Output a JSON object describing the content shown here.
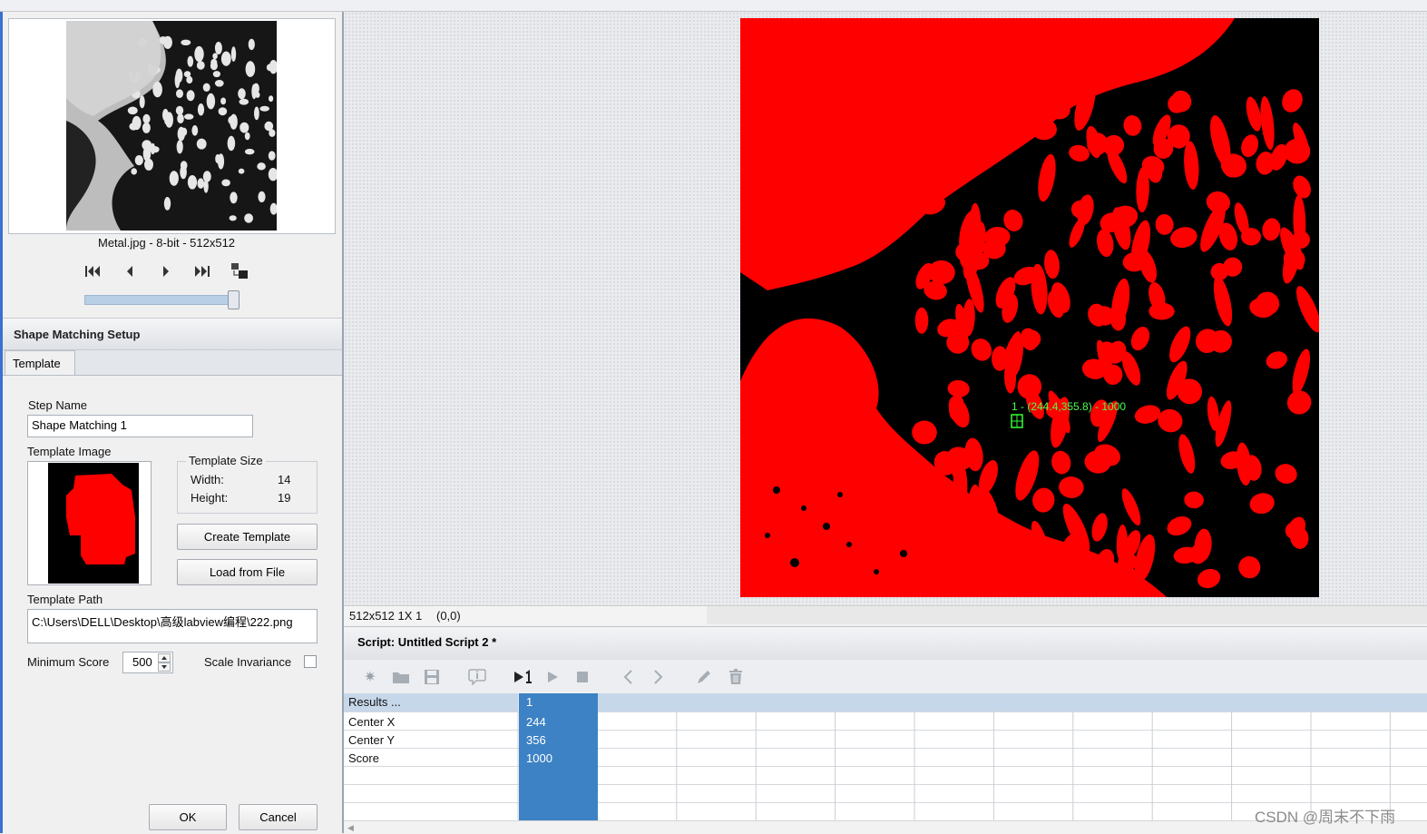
{
  "thumbnail": {
    "caption": "Metal.jpg - 8-bit - 512x512"
  },
  "setup": {
    "title": "Shape Matching Setup",
    "tab": "Template",
    "step_name_label": "Step Name",
    "step_name_value": "Shape Matching 1",
    "template_image_label": "Template Image",
    "template_size_label": "Template Size",
    "width_label": "Width:",
    "width_value": "14",
    "height_label": "Height:",
    "height_value": "19",
    "create_template": "Create Template",
    "load_from_file": "Load from File",
    "template_path_label": "Template Path",
    "template_path_value": "C:\\Users\\DELL\\Desktop\\高级labview编程\\222.png",
    "min_score_label": "Minimum Score",
    "min_score_value": "500",
    "scale_invariance_label": "Scale Invariance",
    "scale_invariance_checked": false,
    "ok": "OK",
    "cancel": "Cancel"
  },
  "image_view": {
    "match_label": "1 - (244.4,355.8) - 1000",
    "status_info": "512x512 1X 1",
    "status_coords": "(0,0)",
    "colors": {
      "binary_fg": "#ff0000",
      "binary_bg": "#000000",
      "overlay": "#33ff33"
    }
  },
  "script": {
    "title": "Script: Untitled Script 2 *",
    "toolbar_icons": [
      "new-icon",
      "open-icon",
      "save-icon",
      "info-icon",
      "run-once-icon",
      "run-icon",
      "stop-icon",
      "previous-icon",
      "next-icon",
      "edit-icon",
      "delete-icon"
    ]
  },
  "results": {
    "header": "Results ...",
    "columns": [
      "1"
    ],
    "rows": [
      {
        "label": "Center X",
        "value": "244"
      },
      {
        "label": "Center Y",
        "value": "356"
      },
      {
        "label": "Score",
        "value": "1000"
      }
    ]
  },
  "watermark": "CSDN @周末不下雨"
}
